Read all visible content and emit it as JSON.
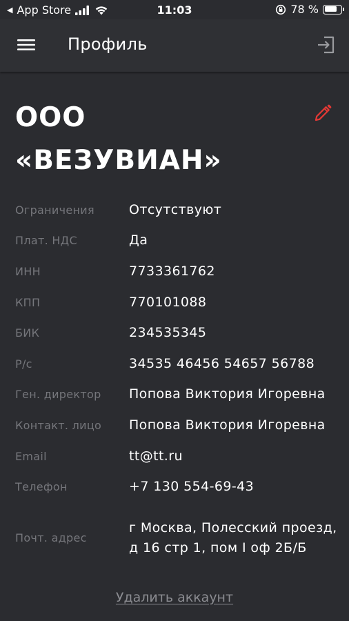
{
  "status_bar": {
    "back_label": "App Store",
    "time": "11:03",
    "battery_percent": 78,
    "battery_label": "78 %"
  },
  "header": {
    "title": "Профиль",
    "menu_icon": "hamburger-menu-icon",
    "logout_icon": "logout-icon"
  },
  "company": {
    "name": "ООО «ВЕЗУВИАН»",
    "edit_icon": "pencil-icon"
  },
  "details": [
    {
      "label": "Ограничения",
      "value": "Отсутствуют"
    },
    {
      "label": "Плат. НДС",
      "value": "Да"
    },
    {
      "label": "ИНН",
      "value": "7733361762"
    },
    {
      "label": "КПП",
      "value": "770101088"
    },
    {
      "label": "БИК",
      "value": "234535345"
    },
    {
      "label": "Р/с",
      "value": "34535 46456 54657 56788"
    },
    {
      "label": "Ген. директор",
      "value": "Попова Виктория Игоревна"
    },
    {
      "label": "Контакт. лицо",
      "value": "Попова Виктория Игоревна"
    },
    {
      "label": "Email",
      "value": "tt@tt.ru"
    },
    {
      "label": "Телефон",
      "value": "+7 130 554-69-43"
    },
    {
      "label": "Почт. адрес",
      "value": "г Москва, Полесский проезд, д 16 стр 1, пом I оф 2Б/Б"
    }
  ],
  "actions": {
    "delete_account": "Удалить аккаунт"
  },
  "colors": {
    "background": "#2b2c30",
    "app_bar": "#2f3034",
    "label": "#75767b",
    "accent_red": "#e53935",
    "link": "#8b8c91"
  }
}
